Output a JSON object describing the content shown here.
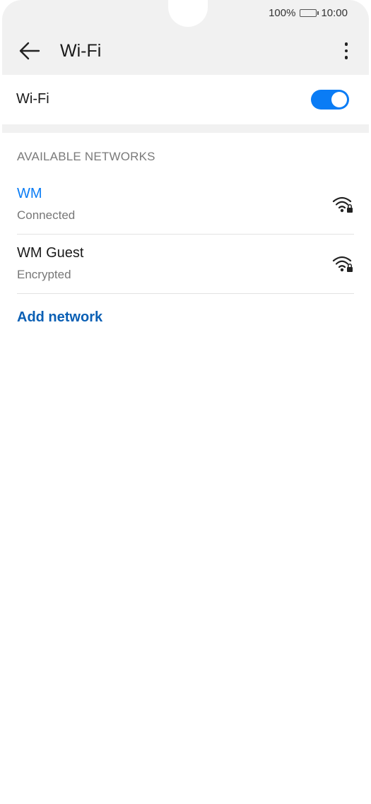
{
  "status_bar": {
    "battery_percent": "100%",
    "time": "10:00",
    "battery_icon": "battery-full-icon"
  },
  "header": {
    "title": "Wi-Fi",
    "back_icon": "arrow-left-icon",
    "menu_icon": "more-vertical-icon"
  },
  "wifi_toggle": {
    "label": "Wi-Fi",
    "enabled": true,
    "accent_color": "#0a7cf5"
  },
  "available_networks": {
    "header": "AVAILABLE NETWORKS",
    "items": [
      {
        "name": "WM",
        "status": "Connected",
        "icon": "wifi-lock-icon",
        "connected": true
      },
      {
        "name": "WM Guest",
        "status": "Encrypted",
        "icon": "wifi-lock-icon",
        "connected": false
      }
    ]
  },
  "add_network": {
    "label": "Add network",
    "color": "#0a5fb4"
  }
}
